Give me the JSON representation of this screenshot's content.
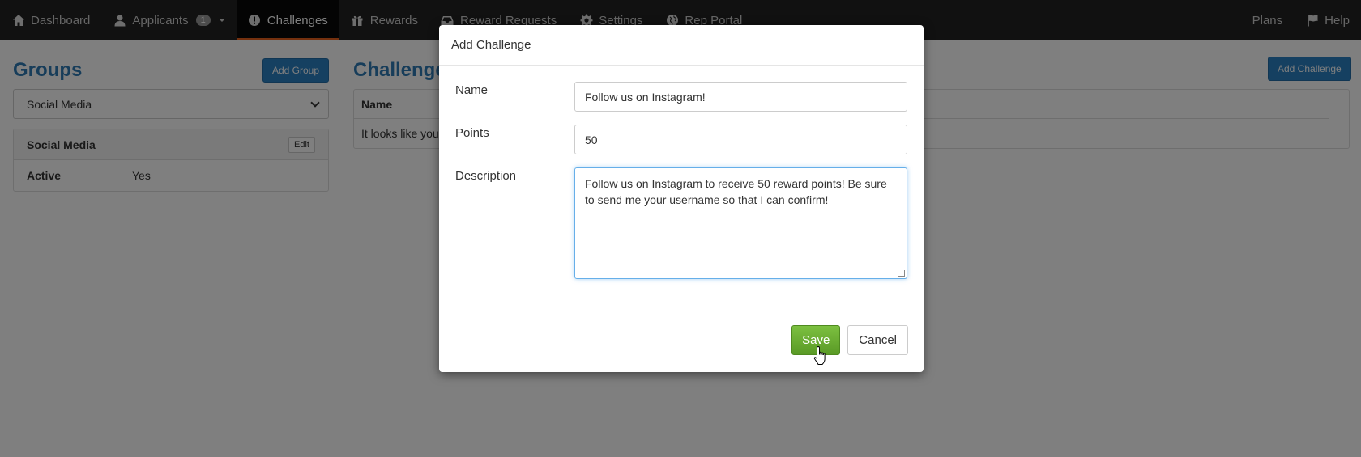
{
  "navbar": {
    "items": [
      {
        "label": "Dashboard",
        "icon": "home-icon"
      },
      {
        "label": "Applicants",
        "icon": "user-icon",
        "badge": "1"
      },
      {
        "label": "Challenges",
        "icon": "exclamation-circle-icon",
        "active": true
      },
      {
        "label": "Rewards",
        "icon": "gift-icon"
      },
      {
        "label": "Reward Requests",
        "icon": "inbox-icon"
      },
      {
        "label": "Settings",
        "icon": "gear-icon"
      },
      {
        "label": "Rep Portal",
        "icon": "globe-icon"
      }
    ],
    "right_items": [
      {
        "label": "Plans"
      },
      {
        "label": "Help",
        "icon": "flag-icon"
      }
    ]
  },
  "groups": {
    "title": "Groups",
    "add_label": "Add Group",
    "selected": "Social Media",
    "panel": {
      "title": "Social Media",
      "edit_label": "Edit",
      "rows": [
        {
          "label": "Active",
          "value": "Yes"
        }
      ]
    }
  },
  "challenges": {
    "title": "Challenges",
    "add_label": "Add Challenge",
    "column_header": "Name",
    "empty_text": "It looks like you"
  },
  "modal": {
    "title": "Add Challenge",
    "fields": {
      "name": {
        "label": "Name",
        "value": "Follow us on Instagram!"
      },
      "points": {
        "label": "Points",
        "value": "50"
      },
      "description": {
        "label": "Description",
        "value": "Follow us on Instagram to receive 50 reward points! Be sure to send me your username so that I can confirm!"
      }
    },
    "save_label": "Save",
    "cancel_label": "Cancel"
  },
  "colors": {
    "navbar_bg": "#222222",
    "active_accent": "#e8601c",
    "primary": "#2b80c2",
    "save_green": "#6ab132"
  }
}
